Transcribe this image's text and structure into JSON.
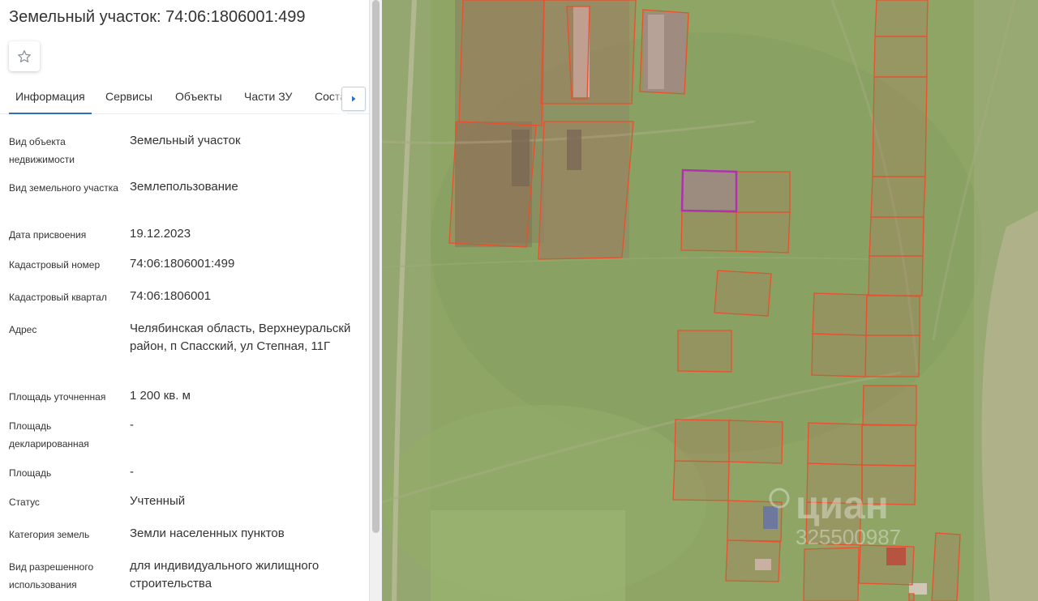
{
  "header": {
    "title": "Земельный участок: 74:06:1806001:499"
  },
  "favorite": {
    "icon": "star-outline-icon"
  },
  "tabs": [
    {
      "label": "Информация",
      "active": true
    },
    {
      "label": "Сервисы",
      "active": false
    },
    {
      "label": "Объекты",
      "active": false
    },
    {
      "label": "Части ЗУ",
      "active": false
    },
    {
      "label": "Состав",
      "active": false
    }
  ],
  "tabs_scroll": {
    "icon": "chevron-right-icon"
  },
  "info": [
    {
      "label": "Вид объекта недвижимости",
      "value": "Земельный участок"
    },
    {
      "label": "Вид земельного участка",
      "value": "Землепользование"
    },
    {
      "label": "Дата присвоения",
      "value": "19.12.2023"
    },
    {
      "label": "Кадастровый номер",
      "value": "74:06:1806001:499"
    },
    {
      "label": "Кадастровый квартал",
      "value": "74:06:1806001"
    },
    {
      "label": "Адрес",
      "value": "Челябинская область, Верхнеуральскй район, п Спасский, ул Степная, 11Г"
    },
    {
      "label": "Площадь уточненная",
      "value": "1 200 кв. м"
    },
    {
      "label": "Площадь декларированная",
      "value": "-"
    },
    {
      "label": "Площадь",
      "value": "-"
    },
    {
      "label": "Статус",
      "value": "Учтенный"
    },
    {
      "label": "Категория земель",
      "value": "Земли населенных пунктов"
    },
    {
      "label": "Вид разрешенного использования",
      "value": "для индивидуального жилищного строительства"
    }
  ],
  "map": {
    "watermark": "циан",
    "watermark_code": "325500987",
    "colors": {
      "parcel_outline": "#e8502e",
      "selected_parcel": "#b030b0",
      "accent": "#2b6fc7"
    }
  }
}
